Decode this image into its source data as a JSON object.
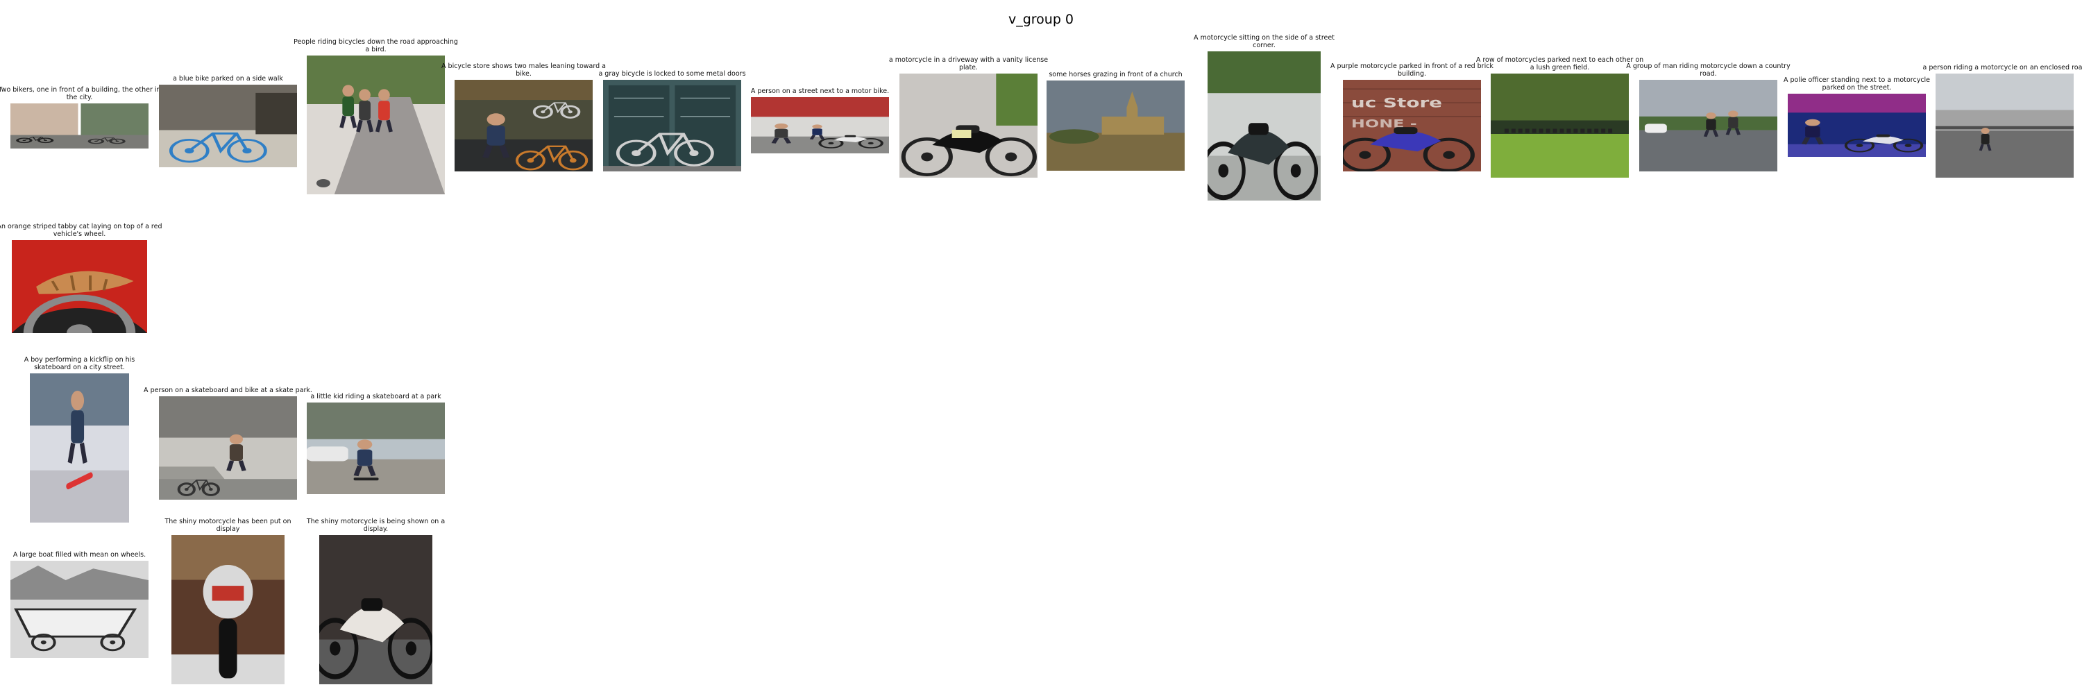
{
  "page": {
    "title": "v_group 0"
  },
  "rows": [
    {
      "items": [
        {
          "caption": "Two bikers, one in front of a building, the other in the city.",
          "scene": "twoBikers",
          "colors": [
            "#cbb6a4",
            "#6c7f64",
            "#8b6b5a"
          ]
        },
        {
          "caption": "a blue bike parked on a side walk",
          "scene": "blueBike",
          "colors": [
            "#6f6a62",
            "#c9c4b9",
            "#2f7fc6"
          ]
        },
        {
          "caption": "People riding bicycles down the road approaching a bird.",
          "scene": "cyclists",
          "colors": [
            "#9b9795",
            "#dcd8d3",
            "#d43a2e"
          ]
        },
        {
          "caption": "A bicycle store shows two males leaning toward a bike.",
          "scene": "bikeStore",
          "colors": [
            "#4a4b3a",
            "#2b2d2e",
            "#c97a2c"
          ]
        },
        {
          "caption": "a gray bicycle is locked to some metal doors",
          "scene": "doors",
          "colors": [
            "#3e5a5c",
            "#2a4143",
            "#8da3a5"
          ]
        },
        {
          "caption": "A person on a street next to a motor bike.",
          "scene": "streetMoto",
          "colors": [
            "#b23532",
            "#d9d8d5",
            "#3a3a3a"
          ]
        },
        {
          "caption": "a motorcycle in a driveway with a vanity license plate.",
          "scene": "drivewayMoto",
          "colors": [
            "#c9c6c2",
            "#111111",
            "#5b7f38"
          ]
        },
        {
          "caption": "some horses grazing in front of a church",
          "scene": "church",
          "colors": [
            "#6f7b86",
            "#7a6a42",
            "#a48a52"
          ]
        },
        {
          "caption": "A motorcycle sitting on the side of a street corner.",
          "scene": "cornerMoto",
          "colors": [
            "#cfd2d0",
            "#2c3537",
            "#4a6a35"
          ]
        },
        {
          "caption": "A purple motorcycle parked in front of a red brick building.",
          "scene": "purpleMoto",
          "colors": [
            "#8a4b3c",
            "#3b38b8",
            "#e7e3dd"
          ]
        },
        {
          "caption": "A row of motorcycles parked next to each other on a lush green field.",
          "scene": "field",
          "colors": [
            "#4f6b2f",
            "#7fae3c",
            "#2a3a24"
          ]
        },
        {
          "caption": "A group of man riding motorcycle down a country road.",
          "scene": "countryRoad",
          "colors": [
            "#a5acb4",
            "#6a6e72",
            "#4c6b3a"
          ]
        },
        {
          "caption": "A polie officer standing next to a  motorcycle parked on the street.",
          "scene": "police",
          "colors": [
            "#1c2a7a",
            "#e0e0e8",
            "#c22f8f"
          ]
        },
        {
          "caption": "a person riding a motorcycle on an enclosed road",
          "scene": "enclosedRoad",
          "colors": [
            "#a3a3a3",
            "#6e6e6e",
            "#4e4e4e"
          ]
        }
      ]
    },
    {
      "items": [
        {
          "caption": "An orange striped tabby cat laying on top of a red vehicle's wheel.",
          "scene": "cat",
          "colors": [
            "#c8241c",
            "#222222",
            "#c98a50"
          ]
        }
      ]
    },
    {
      "items": [
        {
          "caption": "A boy performing a kickflip on his skateboard on a city street.",
          "scene": "kickflip",
          "colors": [
            "#d9dbe2",
            "#6a7b8c",
            "#2c3e5a"
          ]
        },
        {
          "caption": "A person on a skateboard and bike at a skate park.",
          "scene": "skatepark",
          "colors": [
            "#7b7a76",
            "#c8c6c1",
            "#4a3f36"
          ]
        },
        {
          "caption": "a little kid riding a skateboard at a park",
          "scene": "kidSkate",
          "colors": [
            "#b9c2c8",
            "#6f7a6a",
            "#2a3a5a"
          ]
        }
      ]
    },
    {
      "items": [
        {
          "caption": "A large boat filled with mean on wheels.",
          "scene": "boat",
          "colors": [
            "#d8d8d8",
            "#8a8a8a",
            "#2a2a2a"
          ]
        },
        {
          "caption": "The shiny motorcycle has been put on display",
          "scene": "displayFront",
          "colors": [
            "#5a3a2a",
            "#d9d9d9",
            "#c0342a"
          ]
        },
        {
          "caption": "The shiny motorcycle is being shown on a display.",
          "scene": "displaySide",
          "colors": [
            "#3a3432",
            "#e8e4df",
            "#111111"
          ]
        }
      ]
    }
  ]
}
